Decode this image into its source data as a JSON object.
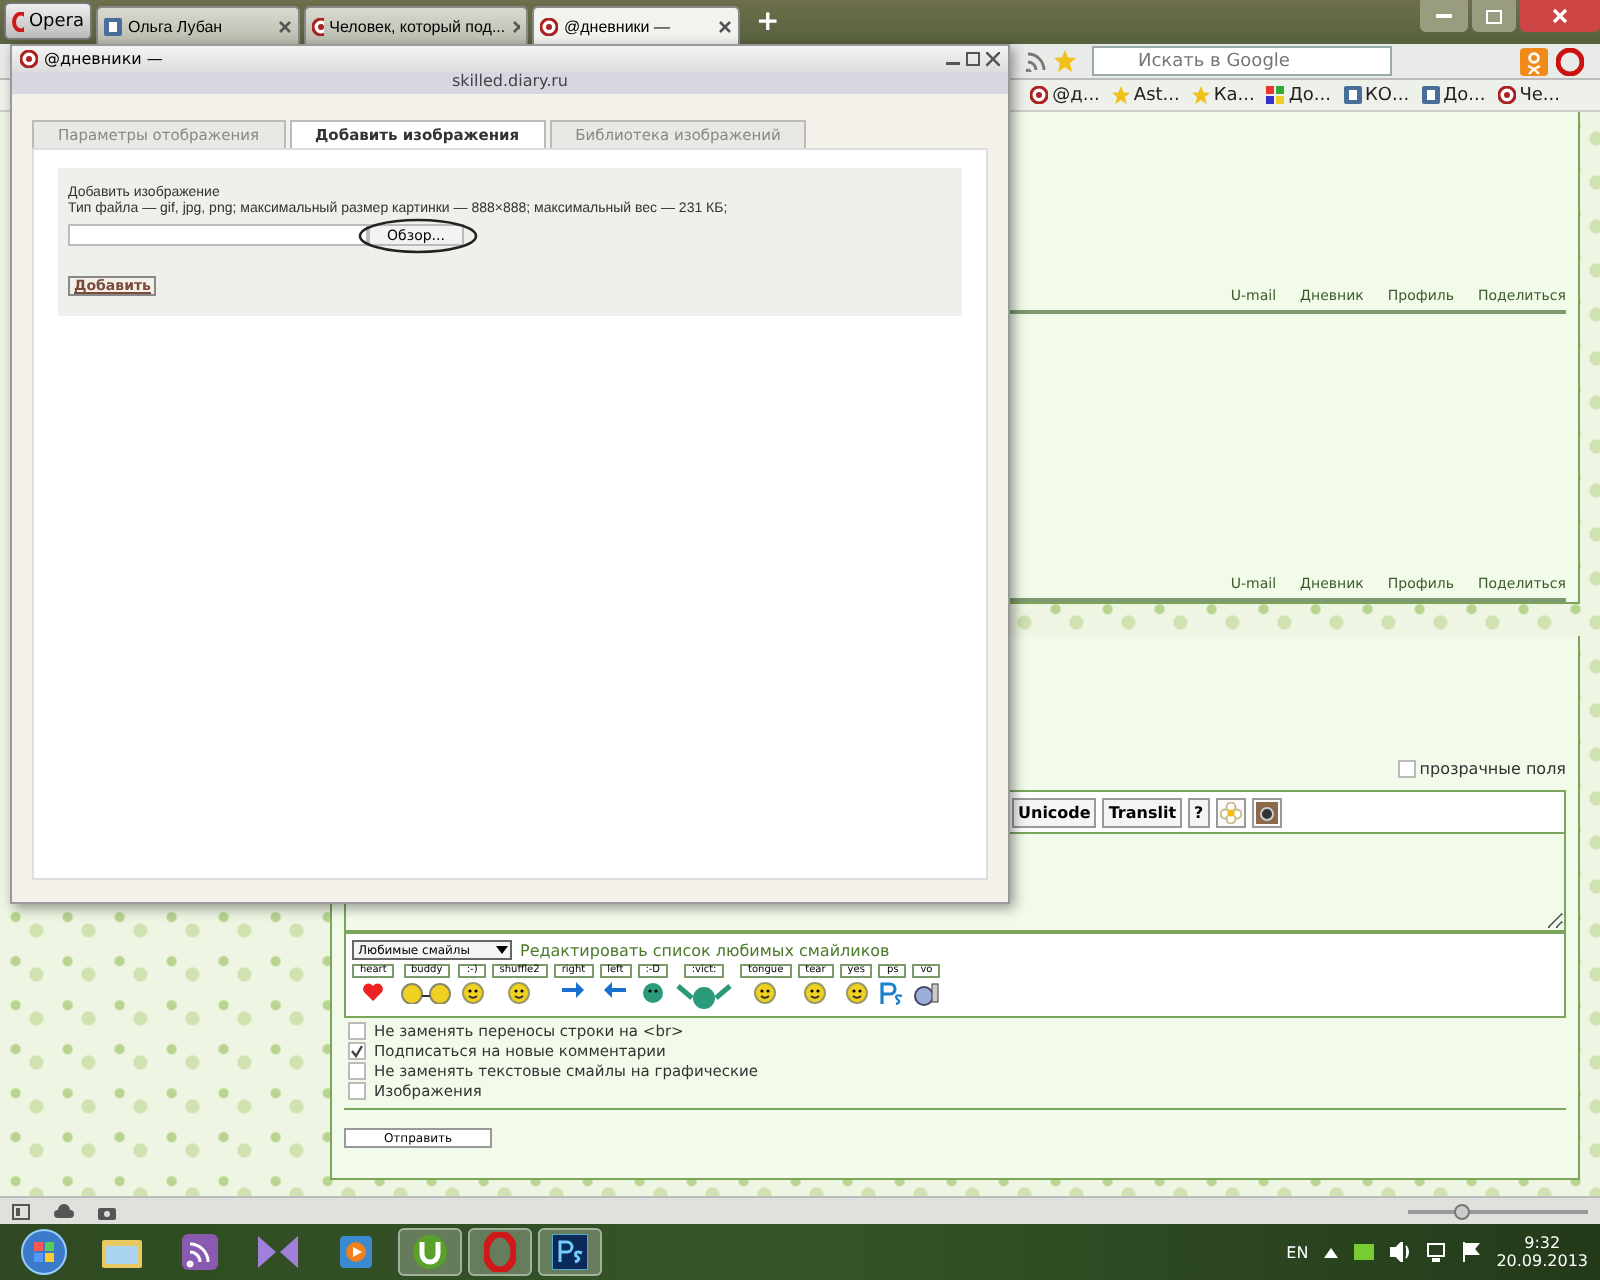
{
  "browser": {
    "menu_button": "Opera",
    "tabs": [
      {
        "title": "Ольга Лубан",
        "kind": "vk",
        "selected": false
      },
      {
        "title": "Человек, который под...",
        "kind": "diary",
        "selected": false
      },
      {
        "title": "@дневники —",
        "kind": "diary",
        "selected": true
      }
    ],
    "zoom": {
      "level": 0.3
    },
    "new_tab": "+",
    "search": {
      "placeholder": "Искать в Google"
    },
    "bookmarks": [
      {
        "label": "@д...",
        "kind": "diary"
      },
      {
        "label": "Ast...",
        "kind": "star"
      },
      {
        "label": "Ка...",
        "kind": "star"
      },
      {
        "label": "До...",
        "kind": "ext"
      },
      {
        "label": "КО...",
        "kind": "vk"
      },
      {
        "label": "До...",
        "kind": "vk"
      },
      {
        "label": "Че...",
        "kind": "diary"
      }
    ]
  },
  "popup": {
    "title": "@дневники —",
    "url": "skilled.diary.ru",
    "tabs": [
      {
        "label": "Параметры отображения",
        "selected": false
      },
      {
        "label": "Добавить изображения",
        "selected": true
      },
      {
        "label": "Библиотека изображений",
        "selected": false
      }
    ],
    "heading": "Добавить изображение",
    "hint": "Тип файла — gif, jpg, png; максимальный размер картинки — 888×888; максимальный вес — 231 КБ;",
    "browse_button": "Обзор...",
    "submit_button": "Добавить"
  },
  "page": {
    "link_rows": [
      [
        "U-mail",
        "Дневник",
        "Профиль",
        "Поделиться"
      ],
      [
        "U-mail",
        "Дневник",
        "Профиль",
        "Поделиться"
      ]
    ],
    "transparent_fields": {
      "label": "прозрачные поля",
      "checked": false
    },
    "toolbar": [
      "Unicode",
      "Translit",
      "?"
    ],
    "smiley_select": "Любимые смайлы",
    "edit_smileys_link": "Редактировать список любимых смайликов",
    "smileys": [
      {
        "label": "heart",
        "kind": "heart"
      },
      {
        "label": "buddy",
        "kind": "pair"
      },
      {
        "label": ":-)",
        "kind": "face"
      },
      {
        "label": "shuffle2",
        "kind": "face"
      },
      {
        "label": "right",
        "kind": "arrow-right"
      },
      {
        "label": "left",
        "kind": "arrow-left"
      },
      {
        "label": ":-D",
        "kind": "green"
      },
      {
        "label": ":vict:",
        "kind": "victory"
      },
      {
        "label": "tongue",
        "kind": "face"
      },
      {
        "label": "tear",
        "kind": "face"
      },
      {
        "label": "yes",
        "kind": "face"
      },
      {
        "label": "ps",
        "kind": "ps"
      },
      {
        "label": "vo",
        "kind": "thumb"
      }
    ],
    "options": [
      {
        "label": "Не заменять переносы строки на <br>",
        "checked": false
      },
      {
        "label": "Подписаться на новые комментарии",
        "checked": true
      },
      {
        "label": "Не заменять текстовые смайлы на графические",
        "checked": false
      },
      {
        "label": "Изображения",
        "checked": false
      }
    ],
    "send_button": "Отправить"
  },
  "taskbar": {
    "apps": [
      {
        "kind": "start",
        "active": false
      },
      {
        "kind": "folder",
        "active": false
      },
      {
        "kind": "rss",
        "active": false
      },
      {
        "kind": "vs",
        "active": false
      },
      {
        "kind": "media",
        "active": false
      },
      {
        "kind": "torrent",
        "active": true
      },
      {
        "kind": "opera",
        "active": true
      },
      {
        "kind": "ps",
        "active": true
      }
    ],
    "language": "EN",
    "time": "9:32",
    "date": "20.09.2013"
  }
}
